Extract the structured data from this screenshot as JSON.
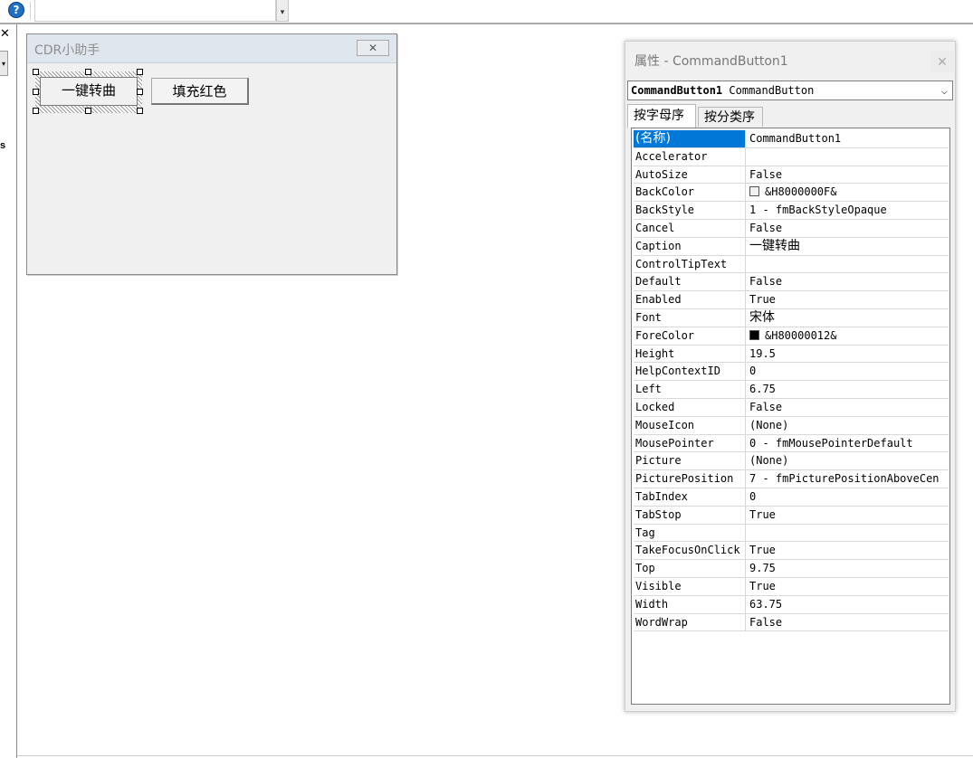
{
  "toolbar": {
    "help_icon": "help-icon",
    "help_glyph": "?"
  },
  "left_panel": {
    "close_glyph": "✕",
    "dropdown_glyph": "▾",
    "fragment_text": "s"
  },
  "form": {
    "title": "CDR小助手",
    "close_glyph": "✕",
    "buttons": [
      {
        "label": "一键转曲"
      },
      {
        "label": "填充红色"
      }
    ]
  },
  "properties": {
    "title": "属性 - CommandButton1",
    "close_glyph": "✕",
    "object_name": "CommandButton1",
    "object_type": "CommandButton",
    "tabs": [
      {
        "label": "按字母序"
      },
      {
        "label": "按分类序"
      }
    ],
    "rows": [
      {
        "name": "(名称)",
        "value": "CommandButton1"
      },
      {
        "name": "Accelerator",
        "value": ""
      },
      {
        "name": "AutoSize",
        "value": "False"
      },
      {
        "name": "BackColor",
        "value": "&H8000000F&",
        "swatch": "#f0f0f0"
      },
      {
        "name": "BackStyle",
        "value": "1 - fmBackStyleOpaque"
      },
      {
        "name": "Cancel",
        "value": "False"
      },
      {
        "name": "Caption",
        "value": "一键转曲"
      },
      {
        "name": "ControlTipText",
        "value": ""
      },
      {
        "name": "Default",
        "value": "False"
      },
      {
        "name": "Enabled",
        "value": "True"
      },
      {
        "name": "Font",
        "value": "宋体"
      },
      {
        "name": "ForeColor",
        "value": "&H80000012&",
        "swatch": "#000000"
      },
      {
        "name": "Height",
        "value": "19.5"
      },
      {
        "name": "HelpContextID",
        "value": "0"
      },
      {
        "name": "Left",
        "value": "6.75"
      },
      {
        "name": "Locked",
        "value": "False"
      },
      {
        "name": "MouseIcon",
        "value": "(None)"
      },
      {
        "name": "MousePointer",
        "value": "0 - fmMousePointerDefault"
      },
      {
        "name": "Picture",
        "value": "(None)"
      },
      {
        "name": "PicturePosition",
        "value": "7 - fmPicturePositionAboveCen"
      },
      {
        "name": "TabIndex",
        "value": "0"
      },
      {
        "name": "TabStop",
        "value": "True"
      },
      {
        "name": "Tag",
        "value": ""
      },
      {
        "name": "TakeFocusOnClick",
        "value": "True"
      },
      {
        "name": "Top",
        "value": "9.75"
      },
      {
        "name": "Visible",
        "value": "True"
      },
      {
        "name": "Width",
        "value": "63.75"
      },
      {
        "name": "WordWrap",
        "value": "False"
      }
    ]
  },
  "colors": {
    "selection": "#0078d7",
    "form_title_bg": "#dfe6ee"
  }
}
